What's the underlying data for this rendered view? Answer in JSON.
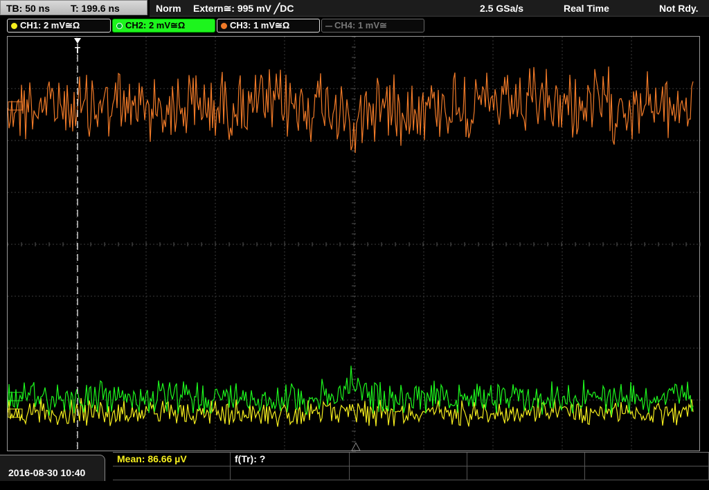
{
  "topbar": {
    "timebase": "TB: 50 ns",
    "trigger_time": "T: 199.6 ns",
    "trigger_mode": "Norm",
    "trigger_source": "Extern≅: 995 mV ╱DC",
    "sample_rate": "2.5 GSa/s",
    "acq_mode": "Real Time",
    "status": "Not Rdy."
  },
  "channels": [
    {
      "label": "CH1: 2 mV≅Ω",
      "color": "#f5ee1e"
    },
    {
      "label": "CH2: 2 mV≅Ω",
      "color": "#1df51d"
    },
    {
      "label": "CH3: 1 mV≅Ω",
      "color": "#f07a28"
    },
    {
      "label": "CH4: 1 mV≅",
      "color": "#777777"
    }
  ],
  "trigger_marker_label": "T",
  "bottom": {
    "datetime": "2016-08-30 10:40",
    "measurements": [
      {
        "label": "Mean: 86.66 µV",
        "color": "#f5ee1e"
      },
      {
        "label": "f(Tr): ?",
        "color": "#ffffff"
      },
      {
        "label": "",
        "color": "#ffffff"
      },
      {
        "label": "",
        "color": "#ffffff"
      },
      {
        "label": "",
        "color": "#ffffff"
      },
      {
        "label": "",
        "color": "#ffffff"
      },
      {
        "label": "",
        "color": "#ffffff"
      },
      {
        "label": "",
        "color": "#ffffff"
      },
      {
        "label": "",
        "color": "#ffffff"
      },
      {
        "label": "",
        "color": "#ffffff"
      }
    ]
  }
}
